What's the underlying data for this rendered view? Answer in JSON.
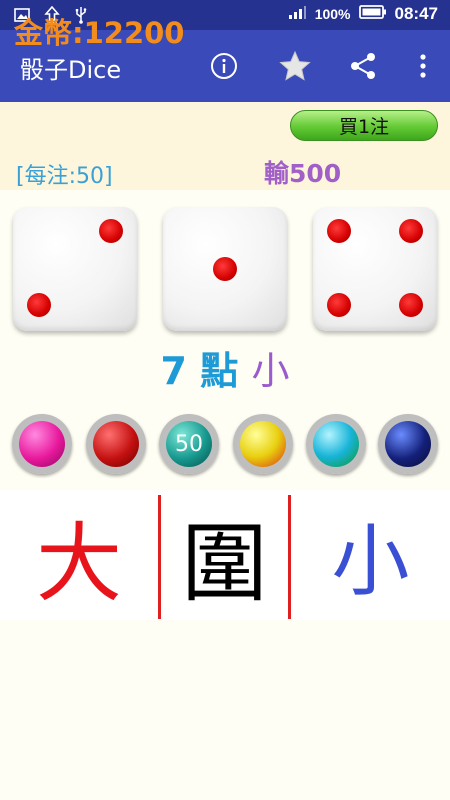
{
  "status_bar": {
    "battery_percent": "100%",
    "time": "08:47"
  },
  "app_bar": {
    "title": "骰子Dice"
  },
  "coins": {
    "label": "金幣:12200",
    "bet_button": "買1注",
    "per_bet": "[每注:50]",
    "result_amount": "輸500"
  },
  "dice": [
    {
      "value": 2
    },
    {
      "value": 1
    },
    {
      "value": 4
    }
  ],
  "result": {
    "points": "7 點",
    "size": "小"
  },
  "chips": [
    {
      "name": "pink-chip",
      "color": "#e8189c",
      "label": ""
    },
    {
      "name": "red-chip",
      "color": "#c41010",
      "label": ""
    },
    {
      "name": "teal-chip",
      "color": "#16988e",
      "label": "50"
    },
    {
      "name": "yellow-chip",
      "color": "#e8d010",
      "label": ""
    },
    {
      "name": "cyan-chip",
      "color": "#18b4d8",
      "label": ""
    },
    {
      "name": "navy-chip",
      "color": "#14207a",
      "label": ""
    }
  ],
  "bet_zones": {
    "big": "大",
    "triple": "圍",
    "small": "小"
  },
  "colors": {
    "status_bar": "#263290",
    "app_bar": "#3a4ab8",
    "coin_text": "#f28c1c",
    "pip": "#d40000"
  }
}
